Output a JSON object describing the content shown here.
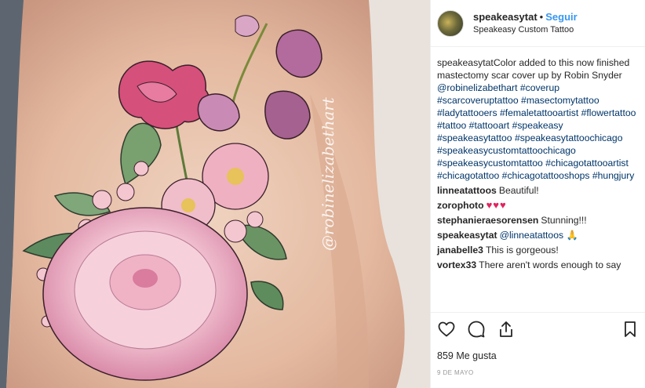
{
  "header": {
    "username": "speakeasytat",
    "separator": "•",
    "follow_label": "Seguir",
    "location": "Speakeasy Custom Tattoo"
  },
  "photo": {
    "watermark": "@robinelizabethart"
  },
  "caption": {
    "username": "speakeasytat",
    "text_before": "Color added to this now finished mastectomy scar cover up by Robin Snyder ",
    "mention": "@robinelizabethart",
    "hashtags": [
      "#coverup",
      "#scarcoveruptattoo",
      "#masectomytattoo",
      "#ladytattooers",
      "#femaletattooartist",
      "#flowertattoo",
      "#tattoo",
      "#tattooart",
      "#speakeasy",
      "#speakeasytattoo",
      "#speakeasytattoochicago",
      "#speakeasycustomtattoochicago",
      "#speakeasycustomtattoo",
      "#chicagotattooartist",
      "#chicagotattoo",
      "#chicagotattooshops",
      "#hungjury"
    ]
  },
  "comments": [
    {
      "user": "linneatattoos",
      "text": "Beautiful!"
    },
    {
      "user": "zorophoto",
      "text": "",
      "emoji": "♥♥♥"
    },
    {
      "user": "stephanieraesorensen",
      "text": "Stunning!!!"
    },
    {
      "user": "speakeasytat",
      "mention": "@linneatattoos",
      "emoji": "🙏"
    },
    {
      "user": "janabelle3",
      "text": "This is gorgeous!"
    },
    {
      "user": "vortex33",
      "text": "There aren't words enough to say"
    }
  ],
  "actions": {
    "icons": [
      "heart-icon",
      "comment-icon",
      "share-icon",
      "bookmark-icon"
    ],
    "likes": "859 Me gusta",
    "date": "9 DE MAYO"
  },
  "colors": {
    "link": "#3897f0",
    "hashtag": "#003569",
    "border": "#efefef",
    "text": "#262626"
  }
}
